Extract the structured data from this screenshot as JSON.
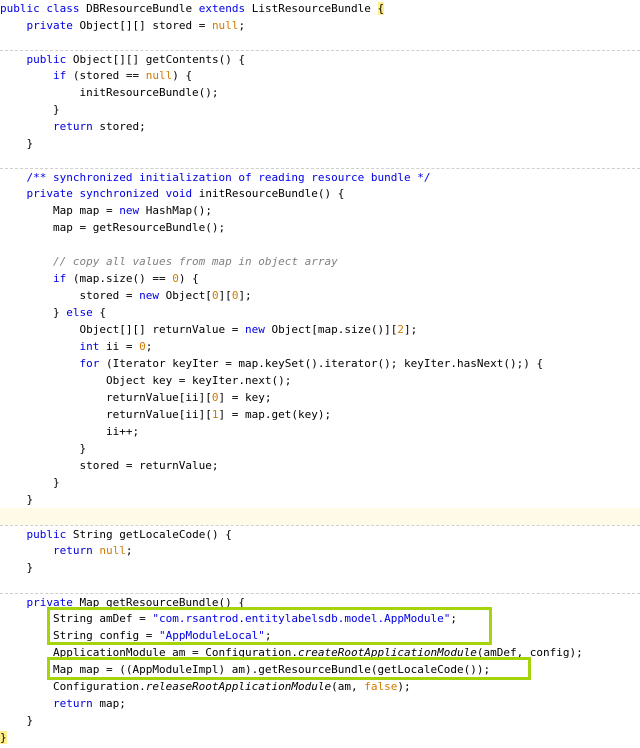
{
  "colors": {
    "keyword": "#0000e6",
    "literal": "#ce7b00",
    "comment": "#808080",
    "highlight_box": "#a6d40a",
    "brace_match": "#ffef8a",
    "current_line": "#fffbe6"
  },
  "code_lines": [
    [
      [
        "k",
        "public"
      ],
      [
        "t",
        " "
      ],
      [
        "k",
        "class"
      ],
      [
        "t",
        " DBResourceBundle "
      ],
      [
        "k",
        "extends"
      ],
      [
        "t",
        " ListResourceBundle "
      ],
      [
        "bh",
        "{"
      ]
    ],
    [
      [
        "t",
        "    "
      ],
      [
        "k",
        "private"
      ],
      [
        "t",
        " Object[][] stored = "
      ],
      [
        "nu",
        "null"
      ],
      [
        "t",
        ";"
      ]
    ],
    [],
    [
      [
        "t",
        "    "
      ],
      [
        "k",
        "public"
      ],
      [
        "t",
        " Object[][] getContents() {"
      ]
    ],
    [
      [
        "t",
        "        "
      ],
      [
        "k",
        "if"
      ],
      [
        "t",
        " (stored == "
      ],
      [
        "nu",
        "null"
      ],
      [
        "t",
        ") {"
      ]
    ],
    [
      [
        "t",
        "            initResourceBundle();"
      ]
    ],
    [
      [
        "t",
        "        }"
      ]
    ],
    [
      [
        "t",
        "        "
      ],
      [
        "k",
        "return"
      ],
      [
        "t",
        " stored;"
      ]
    ],
    [
      [
        "t",
        "    }"
      ]
    ],
    [],
    [
      [
        "t",
        "    "
      ],
      [
        "c",
        "/** synchronized initialization of reading resource bundle */"
      ]
    ],
    [
      [
        "t",
        "    "
      ],
      [
        "k",
        "private"
      ],
      [
        "t",
        " "
      ],
      [
        "k",
        "synchronized"
      ],
      [
        "t",
        " "
      ],
      [
        "k",
        "void"
      ],
      [
        "t",
        " initResourceBundle() {"
      ]
    ],
    [
      [
        "t",
        "        Map map = "
      ],
      [
        "k",
        "new"
      ],
      [
        "t",
        " HashMap();"
      ]
    ],
    [
      [
        "t",
        "        map = getResourceBundle();"
      ]
    ],
    [],
    [
      [
        "t",
        "        "
      ],
      [
        "cm",
        "// copy all values from map in object array"
      ]
    ],
    [
      [
        "t",
        "        "
      ],
      [
        "k",
        "if"
      ],
      [
        "t",
        " (map.size() == "
      ],
      [
        "nu",
        "0"
      ],
      [
        "t",
        ") {"
      ]
    ],
    [
      [
        "t",
        "            stored = "
      ],
      [
        "k",
        "new"
      ],
      [
        "t",
        " Object["
      ],
      [
        "nu",
        "0"
      ],
      [
        "t",
        "]["
      ],
      [
        "nu",
        "0"
      ],
      [
        "t",
        "];"
      ]
    ],
    [
      [
        "t",
        "        } "
      ],
      [
        "k",
        "else"
      ],
      [
        "t",
        " {"
      ]
    ],
    [
      [
        "t",
        "            Object[][] returnValue = "
      ],
      [
        "k",
        "new"
      ],
      [
        "t",
        " Object[map.size()]["
      ],
      [
        "nu",
        "2"
      ],
      [
        "t",
        "];"
      ]
    ],
    [
      [
        "t",
        "            "
      ],
      [
        "k",
        "int"
      ],
      [
        "t",
        " ii = "
      ],
      [
        "nu",
        "0"
      ],
      [
        "t",
        ";"
      ]
    ],
    [
      [
        "t",
        "            "
      ],
      [
        "k",
        "for"
      ],
      [
        "t",
        " (Iterator keyIter = map.keySet().iterator(); keyIter.hasNext();) {"
      ]
    ],
    [
      [
        "t",
        "                Object key = keyIter.next();"
      ]
    ],
    [
      [
        "t",
        "                returnValue[ii]["
      ],
      [
        "nu",
        "0"
      ],
      [
        "t",
        "] = key;"
      ]
    ],
    [
      [
        "t",
        "                returnValue[ii]["
      ],
      [
        "nu",
        "1"
      ],
      [
        "t",
        "] = map.get(key);"
      ]
    ],
    [
      [
        "t",
        "                ii++;"
      ]
    ],
    [
      [
        "t",
        "            }"
      ]
    ],
    [
      [
        "t",
        "            stored = returnValue;"
      ]
    ],
    [
      [
        "t",
        "        }"
      ]
    ],
    [
      [
        "t",
        "    }"
      ]
    ],
    [],
    [
      [
        "t",
        "    "
      ],
      [
        "k",
        "public"
      ],
      [
        "t",
        " String getLocaleCode() {"
      ]
    ],
    [
      [
        "t",
        "        "
      ],
      [
        "k",
        "return"
      ],
      [
        "t",
        " "
      ],
      [
        "nu",
        "null"
      ],
      [
        "t",
        ";"
      ]
    ],
    [
      [
        "t",
        "    }"
      ]
    ],
    [],
    [
      [
        "t",
        "    "
      ],
      [
        "k",
        "private"
      ],
      [
        "t",
        " Map getResourceBundle() {"
      ]
    ],
    [
      [
        "t",
        "        String amDef = "
      ],
      [
        "s2",
        "\"com.rsantrod.entitylabelsdb.model.AppModule\""
      ],
      [
        "t",
        ";"
      ]
    ],
    [
      [
        "t",
        "        String config = "
      ],
      [
        "s2",
        "\"AppModuleLocal\""
      ],
      [
        "t",
        ";"
      ]
    ],
    [
      [
        "t",
        "        ApplicationModule am = Configuration."
      ],
      [
        "it",
        "createRootApplicationModule"
      ],
      [
        "t",
        "(amDef, config);"
      ]
    ],
    [
      [
        "t",
        "        Map map = ((AppModuleImpl) am).getResourceBundle(getLocaleCode());"
      ]
    ],
    [
      [
        "t",
        "        Configuration."
      ],
      [
        "it",
        "releaseRootApplicationModule"
      ],
      [
        "t",
        "(am, "
      ],
      [
        "nu",
        "false"
      ],
      [
        "t",
        ");"
      ]
    ],
    [
      [
        "t",
        "        "
      ],
      [
        "k",
        "return"
      ],
      [
        "t",
        " map;"
      ]
    ],
    [
      [
        "t",
        "    }"
      ]
    ],
    [
      [
        "bh",
        "}"
      ]
    ]
  ]
}
